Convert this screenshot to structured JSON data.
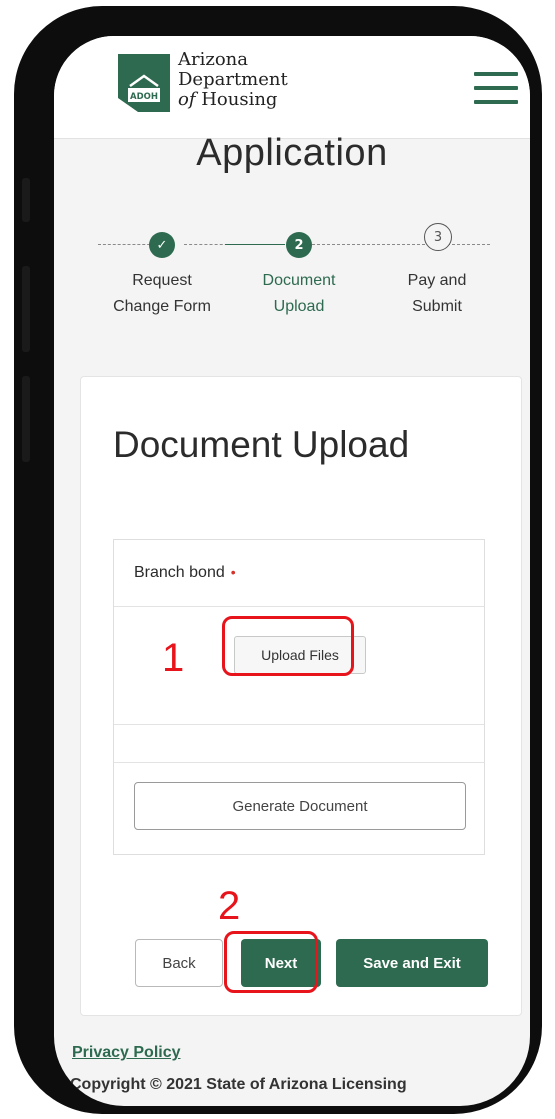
{
  "header": {
    "logo_abbrev": "ADOH",
    "logo_line1": "Arizona",
    "logo_line2": "Department",
    "logo_line3_italic": "of",
    "logo_line3_rest": " Housing",
    "menu_icon": "hamburger-menu-icon"
  },
  "page_title": "Application",
  "stepper": {
    "steps": [
      {
        "marker": "✓",
        "label_line1": "Request",
        "label_line2": "Change Form",
        "state": "complete"
      },
      {
        "marker": "2",
        "label_line1": "Document",
        "label_line2": "Upload",
        "state": "active"
      },
      {
        "marker": "3",
        "label_line1": "Pay and",
        "label_line2": "Submit",
        "state": "todo"
      }
    ]
  },
  "card": {
    "title": "Document Upload",
    "document": {
      "label": "Branch bond",
      "required_marker": "•",
      "upload_label": "Upload Files",
      "generate_label": "Generate Document"
    },
    "buttons": {
      "back": "Back",
      "next": "Next",
      "save_exit": "Save and Exit"
    }
  },
  "footer": {
    "privacy": "Privacy Policy",
    "copyright": "Copyright © 2021 State of Arizona Licensing"
  },
  "annotations": {
    "step1": "1",
    "step2": "2"
  },
  "colors": {
    "brand_green": "#2d6a4f",
    "annotation_red": "#e8141b"
  }
}
